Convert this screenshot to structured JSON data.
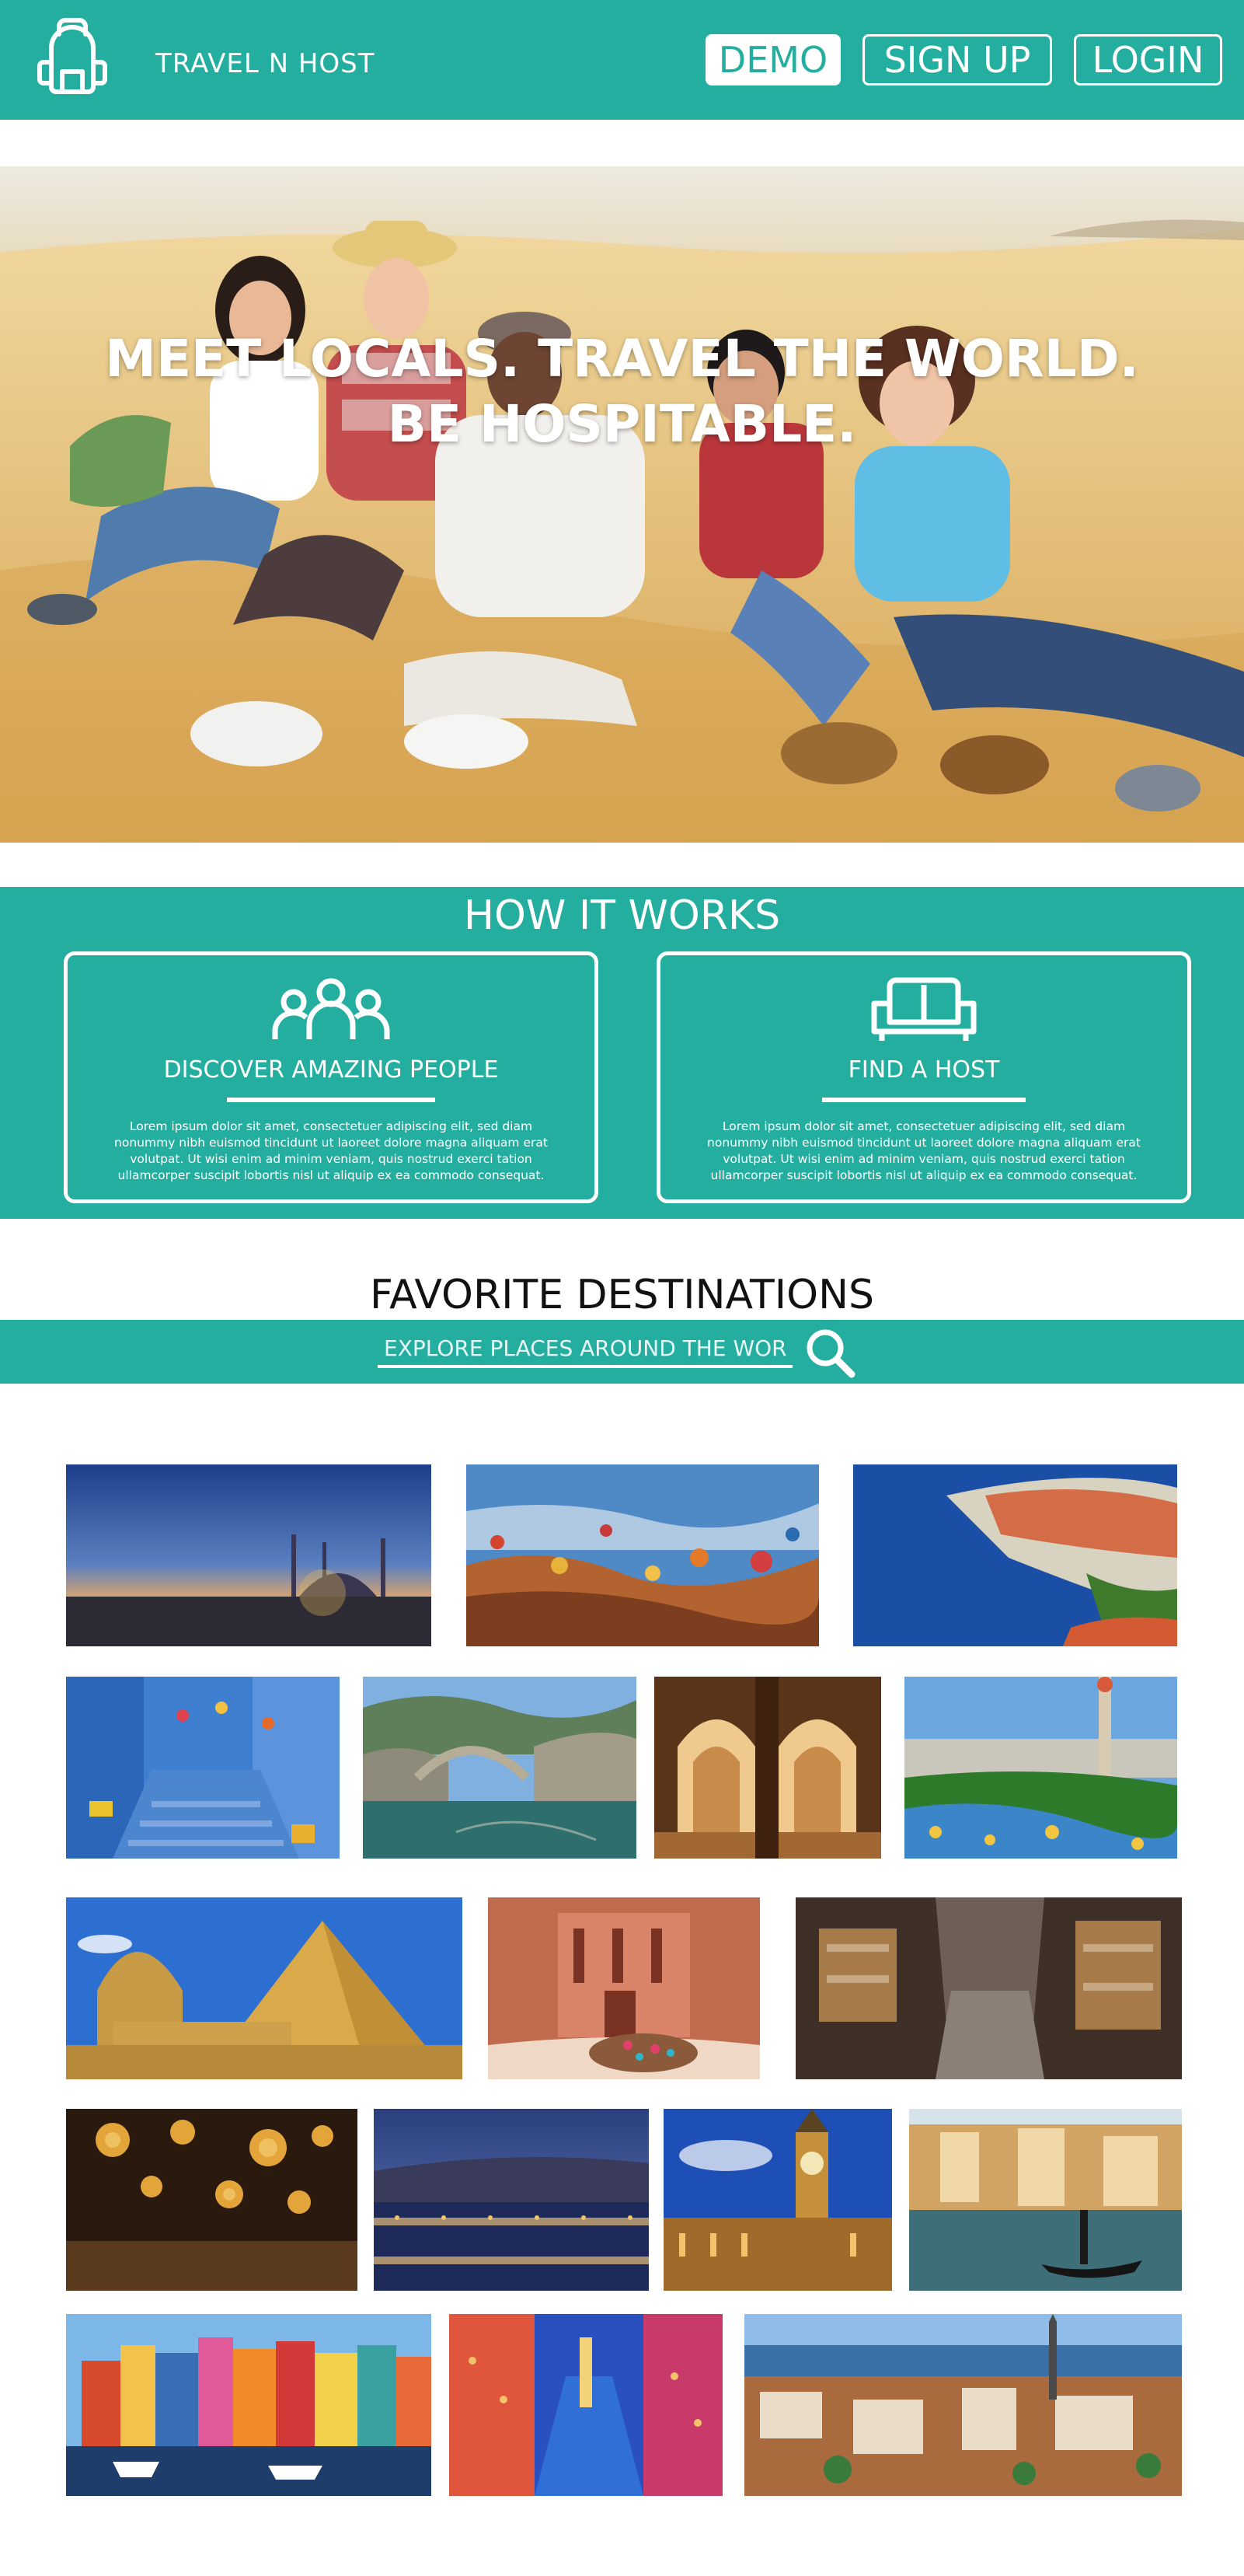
{
  "header": {
    "brand": "TRAVEL N HOST",
    "buttons": {
      "demo": "DEMO",
      "signup": "SIGN UP",
      "login": "LOGIN"
    },
    "logo_icon": "backpack-icon"
  },
  "hero": {
    "line1": "MEET LOCALS. TRAVEL THE WORLD.",
    "line2": "BE HOSPITABLE."
  },
  "how_it_works": {
    "title": "HOW IT WORKS",
    "cards": [
      {
        "icon": "people-group-icon",
        "title": "DISCOVER AMAZING PEOPLE",
        "text": "Lorem ipsum dolor sit amet, consectetuer adipiscing elit, sed diam nonummy nibh euismod tincidunt ut laoreet dolore magna aliquam erat volutpat. Ut wisi enim ad minim veniam, quis nostrud exerci tation ullamcorper suscipit lobortis nisl ut aliquip ex ea commodo consequat."
      },
      {
        "icon": "couch-icon",
        "title": "FIND A HOST",
        "text": "Lorem ipsum dolor sit amet, consectetuer adipiscing elit, sed diam nonummy nibh euismod tincidunt ut laoreet dolore magna aliquam erat volutpat. Ut wisi enim ad minim veniam, quis nostrud exerci tation ullamcorper suscipit lobortis nisl ut aliquip ex ea commodo consequat."
      }
    ]
  },
  "favorites": {
    "title": "FAVORITE DESTINATIONS",
    "search": {
      "placeholder": "EXPLORE PLACES AROUND THE WORLD",
      "icon": "search-icon"
    }
  },
  "colors": {
    "accent": "#23ae9f",
    "text_dark": "#111111",
    "white": "#ffffff"
  }
}
